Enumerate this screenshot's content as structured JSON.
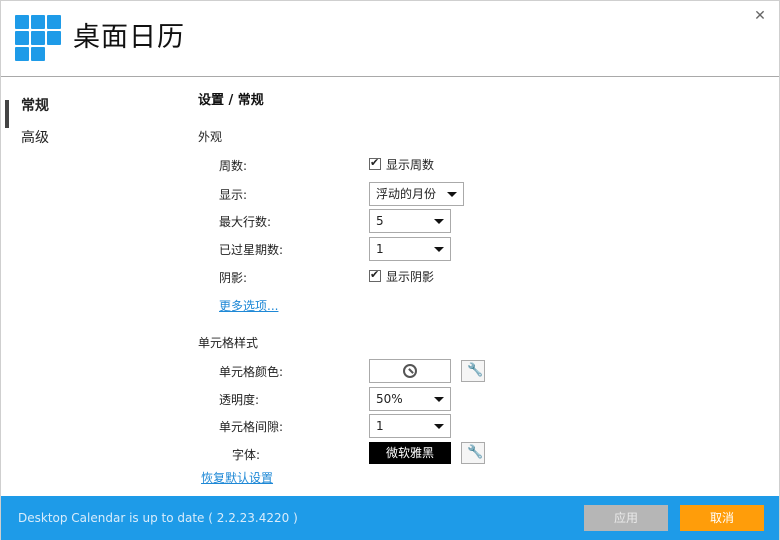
{
  "app": {
    "title": "桌面日历"
  },
  "sidebar": {
    "items": [
      {
        "label": "常规",
        "active": true
      },
      {
        "label": "高级",
        "active": false
      }
    ]
  },
  "main": {
    "title": "设置 / 常规",
    "appearance": {
      "section_title": "外观",
      "week_number": {
        "label": "周数:",
        "checkbox_label": "显示周数",
        "checked": true
      },
      "display": {
        "label": "显示:",
        "value": "浮动的月份"
      },
      "max_rows": {
        "label": "最大行数:",
        "value": "5"
      },
      "past_weeks": {
        "label": "已过星期数:",
        "value": "1"
      },
      "shadow": {
        "label": "阴影:",
        "checkbox_label": "显示阴影",
        "checked": true
      },
      "more_options": "更多选项..."
    },
    "cell_style": {
      "section_title": "单元格样式",
      "cell_color": {
        "label": "单元格颜色:"
      },
      "transparency": {
        "label": "透明度:",
        "value": "50%"
      },
      "cell_spacing": {
        "label": "单元格间隙:",
        "value": "1"
      },
      "font": {
        "label": "字体:",
        "value": "微软雅黑"
      }
    },
    "restore_defaults": "恢复默认设置"
  },
  "footer": {
    "status": "Desktop Calendar is up to date ( 2.2.23.4220 )",
    "apply_label": "应用",
    "cancel_label": "取消"
  },
  "colors": {
    "accent": "#1e9be8",
    "cancel": "#ff9d0a",
    "apply_disabled": "#b6b6b6",
    "link": "#1e88d6"
  }
}
